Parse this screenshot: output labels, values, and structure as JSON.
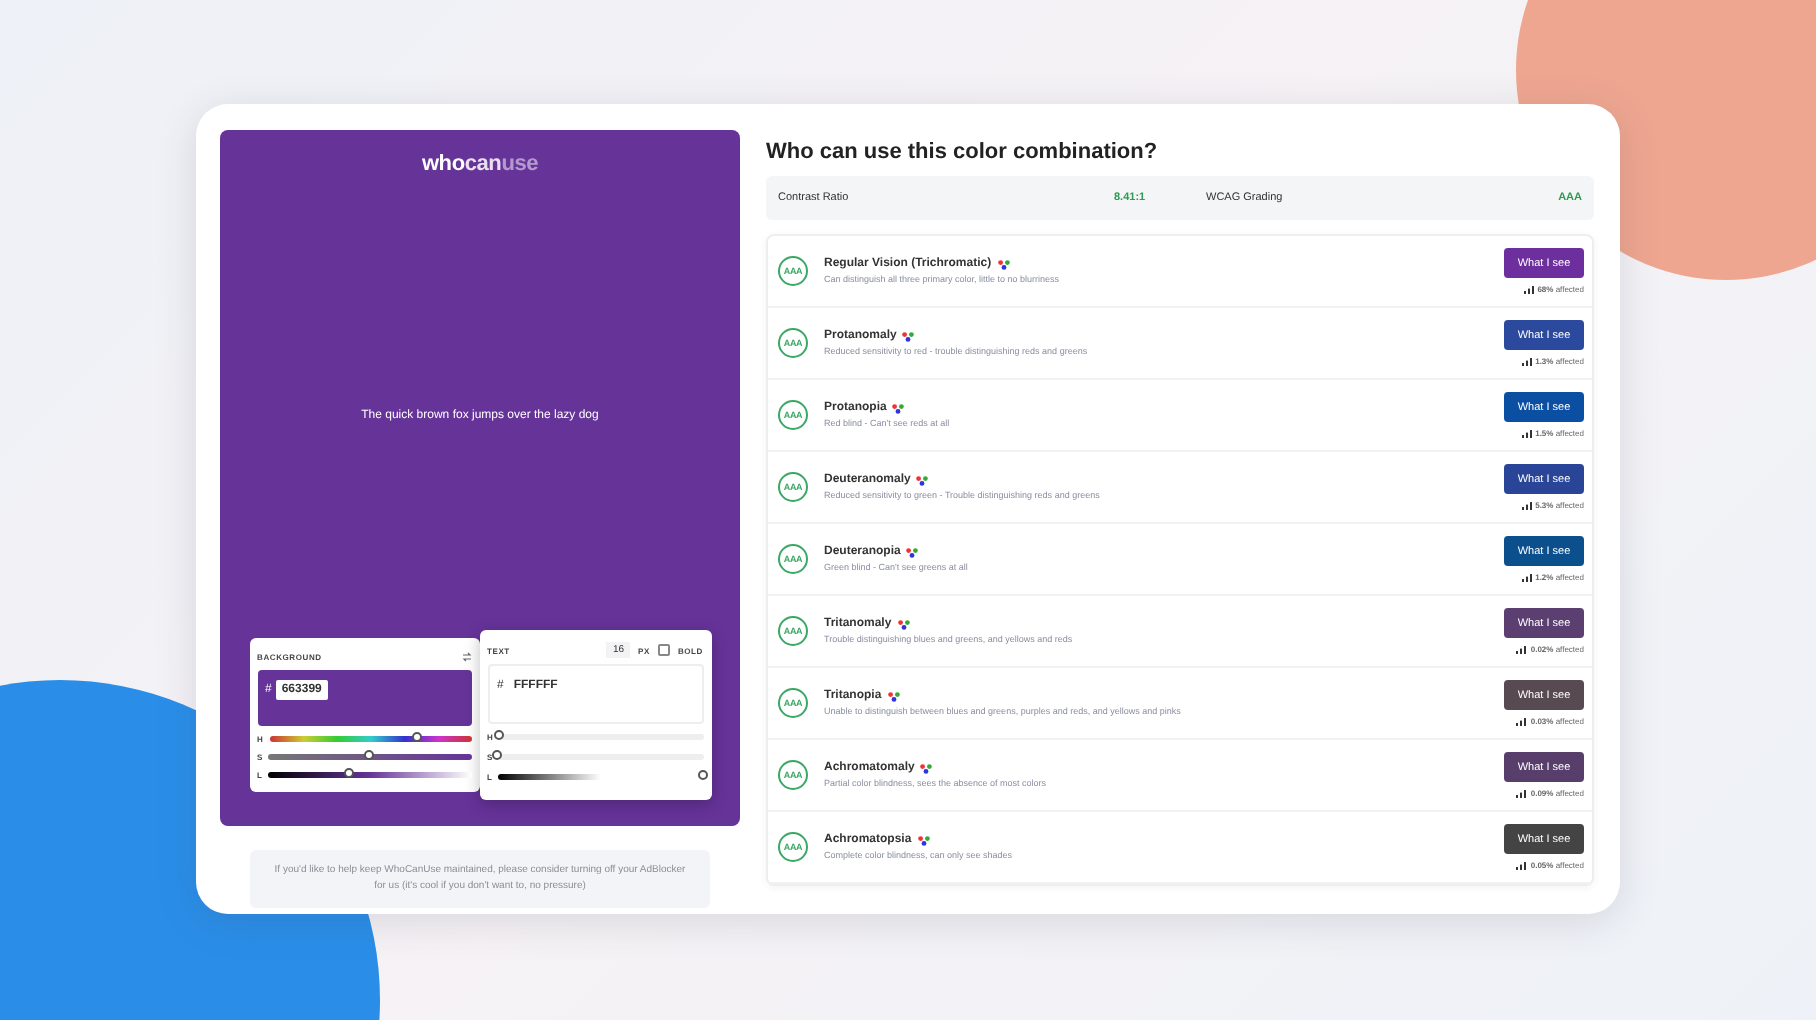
{
  "logo": [
    "who",
    "can",
    "use"
  ],
  "sample_text": "The quick brown fox jumps over the lazy dog",
  "background_picker": {
    "label": "BACKGROUND",
    "hash": "#",
    "value": "663399",
    "color": "#663399",
    "sliders": [
      {
        "label": "H",
        "level": 0.74
      },
      {
        "label": "S",
        "level": 0.5
      },
      {
        "label": "L",
        "level": 0.4
      }
    ]
  },
  "text_picker": {
    "label": "TEXT",
    "size": "16",
    "unit": "PX",
    "bold": {
      "label": "BOLD",
      "checked": false
    },
    "hash": "#",
    "value": "FFFFFF",
    "color": "#ffffff",
    "sliders": [
      {
        "label": "H",
        "level": 0
      },
      {
        "label": "S",
        "level": 0
      },
      {
        "label": "L",
        "level": 1
      }
    ]
  },
  "ad_note": "If you'd like to help keep WhoCanUse maintained, please consider turning off your AdBlocker for us (it's cool if you don't want to, no pressure)",
  "title": "Who can use this color combination?",
  "contrast": {
    "ratio_label": "Contrast Ratio",
    "ratio": "8.41:1",
    "grading_label": "WCAG Grading",
    "grade": "AAA"
  },
  "rows": [
    {
      "badge": "AAA",
      "name": "Regular Vision (Trichromatic)",
      "description": "Can distinguish all three primary color, little to no blurriness",
      "button": "What I see",
      "color": "#6d2f9e",
      "affected": "**68%** affected"
    },
    {
      "badge": "AAA",
      "name": "Protanomaly",
      "description": "Reduced sensitivity to red - trouble distinguishing reds and greens",
      "button": "What I see",
      "color": "#2b4a9e",
      "affected": "**1.3%** affected"
    },
    {
      "badge": "AAA",
      "name": "Protanopia",
      "description": "Red blind - Can't see reds at all",
      "button": "What I see",
      "color": "#0b4fa3",
      "affected": "**1.5%** affected"
    },
    {
      "badge": "AAA",
      "name": "Deuteranomaly",
      "description": "Reduced sensitivity to green - Trouble distinguishing reds and greens",
      "button": "What I see",
      "color": "#2a4597",
      "affected": "**5.3%** affected"
    },
    {
      "badge": "AAA",
      "name": "Deuteranopia",
      "description": "Green blind - Can't see greens at all",
      "button": "What I see",
      "color": "#0b4f8d",
      "affected": "**1.2%** affected"
    },
    {
      "badge": "AAA",
      "name": "Tritanomaly",
      "description": "Trouble distinguishing blues and greens, and yellows and reds",
      "button": "What I see",
      "color": "#5a3f70",
      "affected": "**0.02%** affected"
    },
    {
      "badge": "AAA",
      "name": "Tritanopia",
      "description": "Unable to distinguish between blues and greens, purples and reds, and yellows and pinks",
      "button": "What I see",
      "color": "#574a50",
      "affected": "**0.03%** affected"
    },
    {
      "badge": "AAA",
      "name": "Achromatomaly",
      "description": "Partial color blindness, sees the absence of most colors",
      "button": "What I see",
      "color": "#573e6b",
      "affected": "**0.09%** affected"
    },
    {
      "badge": "AAA",
      "name": "Achromatopsia",
      "description": "Complete color blindness, can only see shades",
      "button": "What I see",
      "color": "#444444",
      "affected": "**0.05%** affected"
    }
  ]
}
